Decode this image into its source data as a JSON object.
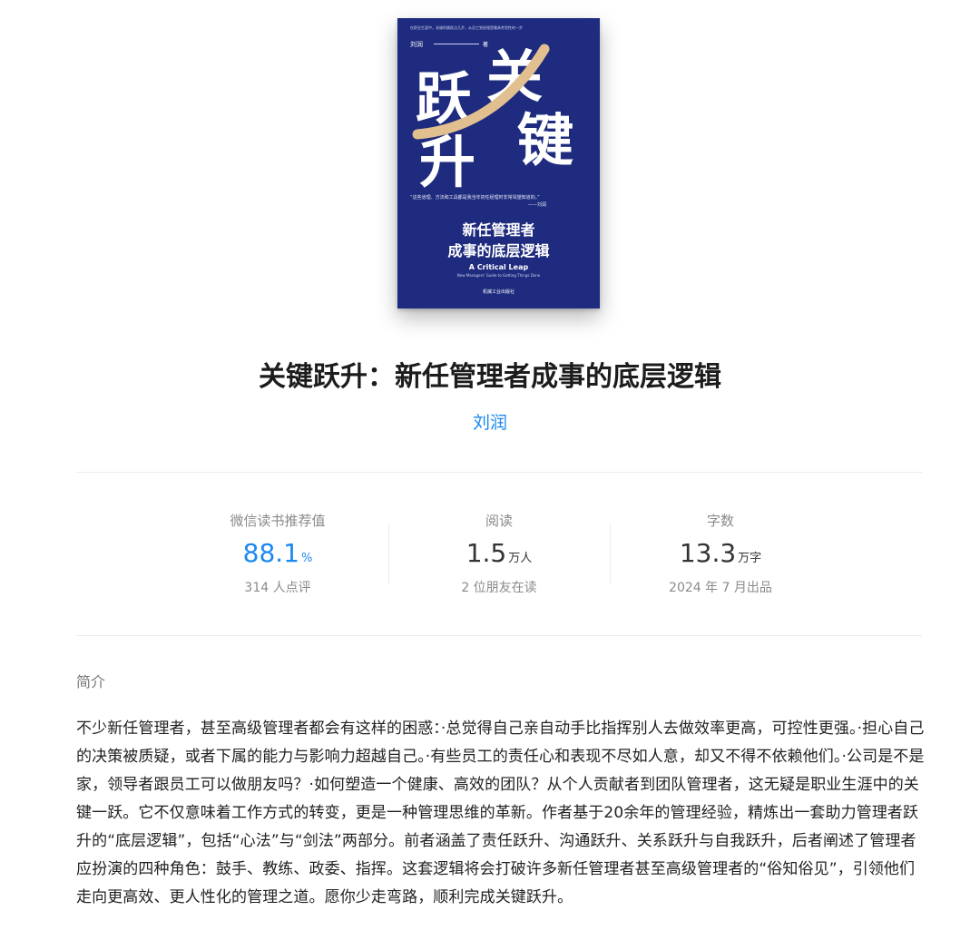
{
  "cover": {
    "tagline": "在职业生涯中，关键的跳跃点几步，从员工到经理是最具考验性的一步",
    "author": "刘润",
    "author_suffix": "著",
    "big_chars": [
      "跃",
      "关",
      "升",
      "键"
    ],
    "quote_line1": "“这些道理、方法和工具都是我当年初任经理时非常渴望知道的。”",
    "quote_line2": "——刘润",
    "subtitle_line1": "新任管理者",
    "subtitle_line2": "成事的底层逻辑",
    "en_title": "A Critical Leap",
    "en_subtitle": "New Managers' Guide to Getting Things Done",
    "publisher": "机械工业出版社",
    "colors": {
      "background": "#1e2b7e",
      "curve": "#e2bf8f"
    }
  },
  "book": {
    "title": "关键跃升：新任管理者成事的底层逻辑",
    "author": "刘润"
  },
  "stats": [
    {
      "label": "微信读书推荐值",
      "value": "88.1",
      "unit": "%",
      "sub": "314 人点评",
      "accent": true
    },
    {
      "label": "阅读",
      "value": "1.5",
      "unit": "万人",
      "sub": "2 位朋友在读",
      "accent": false
    },
    {
      "label": "字数",
      "value": "13.3",
      "unit": "万字",
      "sub": "2024 年 7 月出品",
      "accent": false
    }
  ],
  "intro": {
    "heading": "简介",
    "text": "不少新任管理者，甚至高级管理者都会有这样的困惑：·总觉得自己亲自动手比指挥别人去做效率更高，可控性更强。·担心自己的决策被质疑，或者下属的能力与影响力超越自己。·有些员工的责任心和表现不尽如人意，却又不得不依赖他们。·公司是不是家，领导者跟员工可以做朋友吗？·如何塑造一个健康、高效的团队？从个人贡献者到团队管理者，这无疑是职业生涯中的关键一跃。它不仅意味着工作方式的转变，更是一种管理思维的革新。作者基于20余年的管理经验，精炼出一套助力管理者跃升的“底层逻辑”，包括“心法”与“剑法”两部分。前者涵盖了责任跃升、沟通跃升、关系跃升与自我跃升，后者阐述了管理者应扮演的四种角色：鼓手、教练、政委、指挥。这套逻辑将会打破许多新任管理者甚至高级管理者的“俗知俗见”，引领他们走向更高效、更人性化的管理之道。愿你少走弯路，顺利完成关键跃升。"
  },
  "colors": {
    "accent": "#1b88ee"
  }
}
